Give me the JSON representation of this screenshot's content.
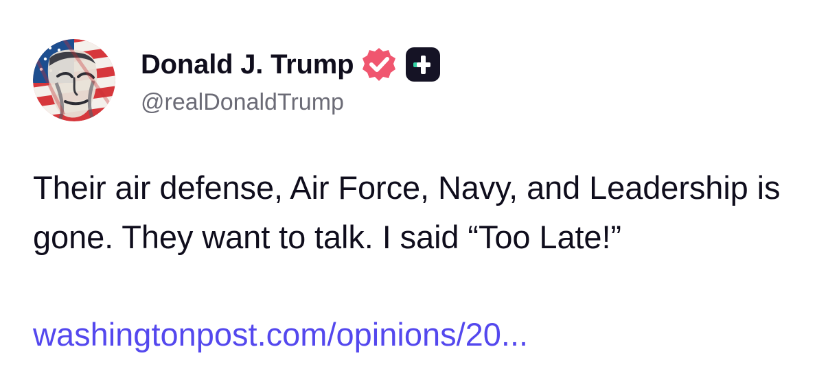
{
  "author": {
    "display_name": "Donald J. Trump",
    "handle": "@realDonaldTrump",
    "avatar_icon": "flag-portrait-avatar",
    "verified_icon": "verified-check-badge",
    "plus_icon": "plus-square-badge"
  },
  "post": {
    "text": "Their air defense, Air Force, Navy, and Leadership is gone. They want to talk. I said “Too Late!”",
    "link_text": "washingtonpost.com/opinions/20..."
  },
  "colors": {
    "text": "#0f0d1c",
    "muted": "#6b6b76",
    "link": "#5448ee",
    "verified_badge": "#f0566f",
    "plus_badge": "#151325",
    "plus_accent": "#34d3a5"
  }
}
